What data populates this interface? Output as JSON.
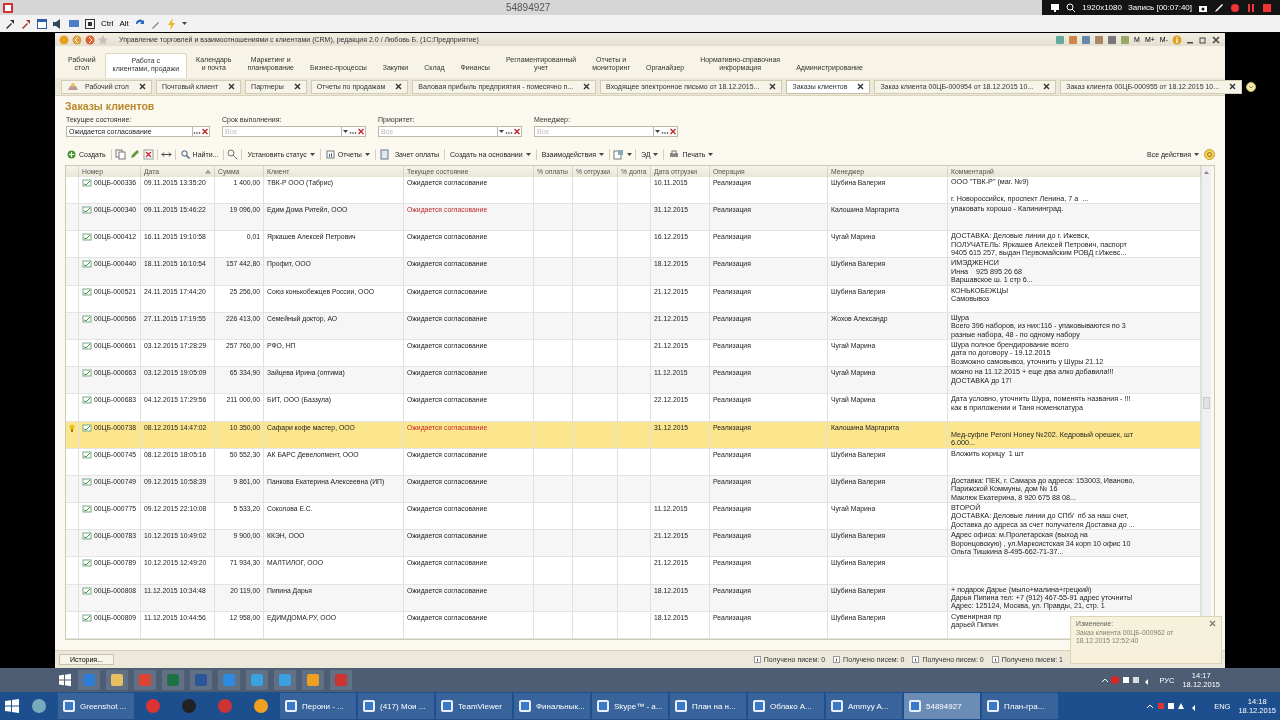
{
  "session_bar": {
    "title": "54894927",
    "resolution": "1920x1080",
    "recording": "Запись [00:07:40]"
  },
  "remote_toolbar": {
    "keys": [
      "Ctrl",
      "Alt"
    ]
  },
  "window": {
    "title": "Управление торговлей и взаимоотношениями с клиентами (CRM), редакция 2.0 / Любовь Б.  (1С:Предприятие)",
    "memory_buttons": [
      "M",
      "M+",
      "M-"
    ]
  },
  "sections": [
    {
      "label": "Рабочий\nстол",
      "selected": false
    },
    {
      "label": "Работа с\nклиентами, продажи",
      "selected": true
    },
    {
      "label": "Календарь\nи почта",
      "selected": false
    },
    {
      "label": "Маркетинг и\nпланирование",
      "selected": false
    },
    {
      "label": "Бизнес-процессы",
      "selected": false
    },
    {
      "label": "Закупки",
      "selected": false
    },
    {
      "label": "Склад",
      "selected": false
    },
    {
      "label": "Финансы",
      "selected": false
    },
    {
      "label": "Регламентированный\nучет",
      "selected": false
    },
    {
      "label": "Отчеты и\nмониторинг",
      "selected": false
    },
    {
      "label": "Органайзер",
      "selected": false
    },
    {
      "label": "Нормативно-справочная\nинформация",
      "selected": false
    },
    {
      "label": "Администрирование",
      "selected": false
    }
  ],
  "tabs": [
    {
      "label": "Рабочий стол",
      "selected": false
    },
    {
      "label": "Почтовый клиент",
      "selected": false
    },
    {
      "label": "Партнеры",
      "selected": false
    },
    {
      "label": "Отчеты по продажам",
      "selected": false
    },
    {
      "label": "Валовая прибыль предприятия - помесячно п...",
      "selected": false
    },
    {
      "label": "Входящее электронное письмо от 18.12.2015...",
      "selected": false
    },
    {
      "label": "Заказы клиентов",
      "selected": true
    },
    {
      "label": "Заказ клиента 00ЦБ-000954 от 18.12.2015 10...",
      "selected": false
    },
    {
      "label": "Заказ клиента 00ЦБ-000955 от 18.12.2015 10...",
      "selected": false
    }
  ],
  "page_title": "Заказы клиентов",
  "filters": [
    {
      "label": "Текущее состояние:",
      "value": "Ожидается согласование"
    },
    {
      "label": "Срок выполнения:",
      "placeholder": "Все"
    },
    {
      "label": "Приоритет:",
      "placeholder": "Все"
    },
    {
      "label": "Менеджер:",
      "placeholder": "Все"
    }
  ],
  "commands": [
    {
      "label": "Создать",
      "dropdown": false
    },
    {
      "label": "Найти...",
      "dropdown": false
    },
    {
      "label": "Установить статус",
      "dropdown": true
    },
    {
      "label": "Отчеты",
      "dropdown": true
    },
    {
      "label": "Зачет оплаты",
      "dropdown": false
    },
    {
      "label": "Создать на основании",
      "dropdown": true
    },
    {
      "label": "Взаимодействия",
      "dropdown": true
    },
    {
      "label": "ЭД",
      "dropdown": true
    },
    {
      "label": "Печать",
      "dropdown": true
    }
  ],
  "all_actions": {
    "label": "Все действия",
    "dropdown": true
  },
  "table": {
    "columns": [
      "Номер",
      "Дата",
      "Сумма",
      "Клиент",
      "Текущее состояние",
      "% оплаты",
      "% отгрузки",
      "% долга",
      "Дата отгрузки",
      "Операция",
      "Менеджер",
      "Комментарий"
    ],
    "rows": [
      {
        "number": "00ЦБ-000336",
        "date": "09.11.2015 13:35:20",
        "sum": "1 400,00",
        "client": "ТВК-Р  ООО  (Табрис)",
        "state": "Ожидается согласование",
        "state_alert": false,
        "ship_date": "10.11.2015",
        "operation": "Реализация",
        "manager": "Шубина Валерия",
        "comment": "ООО \"ТВК-Р\" (маг. №9)\n\nг. Новороссийск, проспект Ленина, 7 а  ...",
        "selected": false
      },
      {
        "number": "00ЦБ-000340",
        "date": "09.11.2015 15:46:22",
        "sum": "19 096,00",
        "client": "Едим Дома Ритейл, ООО",
        "state": "Ожидается согласование",
        "state_alert": true,
        "ship_date": "31.12.2015",
        "operation": "Реализация",
        "manager": "Калошина Маргарита",
        "comment": "упаковать хорошо - Калининград.",
        "selected": false
      },
      {
        "number": "00ЦБ-000412",
        "date": "16.11.2015 19:10:58",
        "sum": "0,01",
        "client": "Яркашев Алексей Петрович",
        "state": "Ожидается согласование",
        "state_alert": false,
        "ship_date": "16.12.2015",
        "operation": "Реализация",
        "manager": "Чугай Марина",
        "comment": "ДОСТАВКА: Деловые линии до г. Ижевск,\nПОЛУЧАТЕЛЬ: Яркашев Алексей Петрович, паспорт\n9405 615 257, выдан Первомайским РОВД г.Ижевс...",
        "selected": false
      },
      {
        "number": "00ЦБ-000440",
        "date": "18.11.2015 16:10:54",
        "sum": "157 442,80",
        "client": "Профит, ООО",
        "state": "Ожидается согласование",
        "state_alert": false,
        "ship_date": "18.12.2015",
        "operation": "Реализация",
        "manager": "Шубина Валерия",
        "comment": "ИМЭДЖЕНСИ\nИнна    925 895 26 68\nВаршавское ш. 1 стр 6...",
        "selected": false
      },
      {
        "number": "00ЦБ-000521",
        "date": "24.11.2015 17:44:20",
        "sum": "25 256,00",
        "client": "Союз конькобежцев России, ООО",
        "state": "Ожидается согласование",
        "state_alert": false,
        "ship_date": "21.12.2015",
        "operation": "Реализация",
        "manager": "Шубина Валерия",
        "comment": "КОНЬКОБЕЖЦЫ\nСамовывоз",
        "selected": false
      },
      {
        "number": "00ЦБ-000566",
        "date": "27.11.2015 17:19:55",
        "sum": "226 413,00",
        "client": "Семейный доктор, АО",
        "state": "Ожидается согласование",
        "state_alert": false,
        "ship_date": "21.12.2015",
        "operation": "Реализация",
        "manager": "Жохов Александр",
        "comment": "Шура\nВсего 396 наборов, из них:116 - упаковываются по 3\nразные набора, 48 - по одному набору",
        "selected": false
      },
      {
        "number": "00ЦБ-000661",
        "date": "03.12.2015 17:28:29",
        "sum": "257 760,00",
        "client": "РФО, НП",
        "state": "Ожидается согласование",
        "state_alert": false,
        "ship_date": "21.12.2015",
        "operation": "Реализация",
        "manager": "Чугай Марина",
        "comment": "Шура полное брендирование всего\nдата по договору - 19.12.2015\nВозможно самовывоз, уточнить у Шуры 21.12",
        "selected": false
      },
      {
        "number": "00ЦБ-000663",
        "date": "03.12.2015 19:05:09",
        "sum": "65 334,90",
        "client": "Зайцева Ирина (оптима)",
        "state": "Ожидается согласование",
        "state_alert": false,
        "ship_date": "11.12.2015",
        "operation": "Реализация",
        "manager": "Чугай Марина",
        "comment": "можно на 11.12.2015 + еще два алко добавила!!!\nДОСТАВКА до 17!",
        "selected": false
      },
      {
        "number": "00ЦБ-000683",
        "date": "04.12.2015 17:29:56",
        "sum": "211 000,00",
        "client": "БИТ, ООО (Баззула)",
        "state": "Ожидается согласование",
        "state_alert": false,
        "ship_date": "22.12.2015",
        "operation": "Реализация",
        "manager": "Чугай Марина",
        "comment": "Дата условно, уточнить Шура, поменять названия - !!!\nкак в приложении и Таня номенклатура",
        "selected": false
      },
      {
        "number": "00ЦБ-000738",
        "date": "08.12.2015 14:47:02",
        "sum": "10 350,00",
        "client": "Сафари кофе мастер, ООО",
        "state": "Ожидается согласование",
        "state_alert": true,
        "ship_date": "31.12.2015",
        "operation": "Реализация",
        "manager": "Калошина Маргарита",
        "comment": "\nМед-суфле Peroni Honey №202. Кедровый орешек, шт\n6.000...",
        "selected": true
      },
      {
        "number": "00ЦБ-000745",
        "date": "08.12.2015 18:05:16",
        "sum": "50 552,30",
        "client": "АК БАРС Девелопмент, ООО",
        "state": "Ожидается согласование",
        "state_alert": false,
        "operation": "Реализация",
        "manager": "Шубина Валерия",
        "comment": "Вложить корицу  1 шт",
        "selected": false
      },
      {
        "number": "00ЦБ-000749",
        "date": "09.12.2015 10:58:39",
        "sum": "9 861,00",
        "client": "Панкова Екатерина Алексеевна (ИП)",
        "state": "Ожидается согласование",
        "state_alert": false,
        "operation": "Реализация",
        "manager": "Шубина Валерия",
        "comment": "Доставка: ПЕК, г. Самара до адреса: 153003, Иваново,\nПарижской Коммуны, дом № 16\nМаклюк Екатерина, 8 920 675 88 08...",
        "selected": false
      },
      {
        "number": "00ЦБ-000775",
        "date": "09.12.2015 22:10:08",
        "sum": "5 533,20",
        "client": "Соколова Е.С.",
        "state": "Ожидается согласование",
        "state_alert": false,
        "ship_date": "11.12.2015",
        "operation": "Реализация",
        "manager": "Чугай Марина",
        "comment": "ВТОРОЙ\nДОСТАВКА: Деловые линии до СПб/  пб за наш счет,\nДоставка до адреса за счет получателя Доставка до ...",
        "selected": false
      },
      {
        "number": "00ЦБ-000783",
        "date": "10.12.2015 10:49:02",
        "sum": "9 900,00",
        "client": "ККЭН, ООО",
        "state": "Ожидается согласование",
        "state_alert": false,
        "ship_date": "21.12.2015",
        "operation": "Реализация",
        "manager": "Шубина Валерия",
        "comment": "Адрес офиса: м.Пролетарская (выход на\nВоронцовскую) , ул.Марксистская 34 корп 10 офис 10\nОльга Тишкина 8-495-662-71-37...",
        "selected": false
      },
      {
        "number": "00ЦБ-000789",
        "date": "10.12.2015 12:49:20",
        "sum": "71 934,30",
        "client": "МАЛТИЛОГ, ООО",
        "state": "Ожидается согласование",
        "state_alert": false,
        "ship_date": "21.12.2015",
        "operation": "Реализация",
        "manager": "Шубина Валерия",
        "selected": false
      },
      {
        "number": "00ЦБ-000808",
        "date": "11.12.2015 10:34:48",
        "sum": "20 119,00",
        "client": "Пипина Дарья",
        "state": "Ожидается согласование",
        "state_alert": false,
        "ship_date": "18.12.2015",
        "operation": "Реализация",
        "manager": "Шубина Валерия",
        "comment": "+ подарок Дарье (мыло+малина+грецкий)\nДарья Пипина тел: +7 (912) 467-55-91 адрес уточнить!\nАдрес: 125124, Москва, ул. Правды, 21, стр. 1",
        "selected": false
      },
      {
        "number": "00ЦБ-000809",
        "date": "11.12.2015 10:44:56",
        "sum": "12 958,00",
        "client": "ЕДИМДОМА.РУ, ООО",
        "state": "Ожидается согласование",
        "state_alert": false,
        "ship_date": "18.12.2015",
        "operation": "Реализация",
        "manager": "Шубина Валерия",
        "comment": "Сувенирная пр\nдарьей Пипин",
        "selected": false
      }
    ]
  },
  "notification": {
    "title": "Изменение:",
    "text": "Заказ клиента 00ЦБ-000962 от\n18.12.2015 12:52:40"
  },
  "status_bar": {
    "history_button": "История...",
    "counters": [
      "Получено писем: 0",
      "Получено писем: 0",
      "Получено писем: 0",
      "Получено писем: 1"
    ]
  },
  "remote_taskbar": {
    "language": "РУС",
    "time": "14:17",
    "date": "18.12.2015"
  },
  "taskbar": {
    "items": [
      {
        "kind": "pinned",
        "active": false
      },
      {
        "kind": "window",
        "label": "Greenshot ...",
        "active": false
      },
      {
        "kind": "pinned",
        "active": false
      },
      {
        "kind": "pinned",
        "active": false
      },
      {
        "kind": "pinned",
        "active": false
      },
      {
        "kind": "pinned",
        "active": false
      },
      {
        "kind": "window",
        "label": "Перони - ...",
        "active": false
      },
      {
        "kind": "window",
        "label": "(417) Мои ...",
        "active": false
      },
      {
        "kind": "window",
        "label": "TeamViewer",
        "active": false
      },
      {
        "kind": "window",
        "label": "Финальнык...",
        "active": false
      },
      {
        "kind": "window",
        "label": "Skype™ - а...",
        "active": false
      },
      {
        "kind": "window",
        "label": "План на н...",
        "active": false
      },
      {
        "kind": "window",
        "label": "Облако А...",
        "active": false
      },
      {
        "kind": "window",
        "label": "Ammyy A...",
        "active": false
      },
      {
        "kind": "window",
        "label": "54894927",
        "active": true
      },
      {
        "kind": "window",
        "label": "План-гра...",
        "active": false
      }
    ],
    "language": "ENG",
    "time": "14:18",
    "date": "18.12.2015"
  }
}
